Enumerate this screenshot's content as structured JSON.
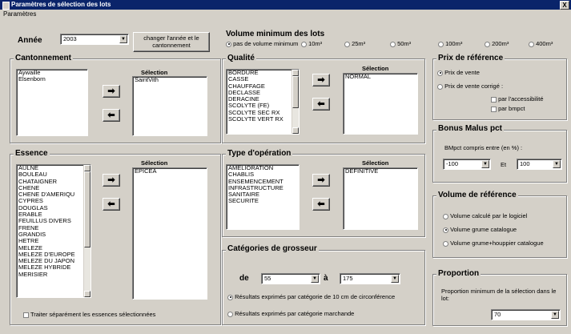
{
  "window": {
    "title": "Paramètres de sélection des lots",
    "close_label": "X"
  },
  "menu": {
    "item": "Paramètres"
  },
  "annee": {
    "label": "Année",
    "value": "2003",
    "change_button": "changer l'année et le cantonnement"
  },
  "volume_min": {
    "title": "Volume minimum des lots",
    "options": [
      "pas de volume minimum",
      "10m³",
      "25m³",
      "50m³",
      "100m³",
      "200m³",
      "400m³"
    ],
    "selected": "pas de volume minimum"
  },
  "cantonnement": {
    "title": "Cantonnement",
    "available": [
      "Aywaille",
      "Elsenborn"
    ],
    "selection_label": "Sélection",
    "selected": [
      "SaintVith"
    ]
  },
  "qualite": {
    "title": "Qualité",
    "available": [
      "BORDURE",
      "CASSE",
      "CHAUFFAGE",
      "DECLASSE",
      "DERACINE",
      "SCOLYTE (FE)",
      "SCOLYTE SEC RX",
      "SCOLYTE VERT RX"
    ],
    "selection_label": "Sélection",
    "selected": [
      "NORMAL"
    ]
  },
  "essence": {
    "title": "Essence",
    "available": [
      "AULNE",
      "BOULEAU",
      "CHATAIGNER",
      "CHENE",
      "CHENE D'AMERIQU",
      "CYPRES",
      "DOUGLAS",
      "ERABLE",
      "FEUILLUS DIVERS",
      "FRENE",
      "GRANDIS",
      "HETRE",
      "MELEZE",
      "MELEZE D'EUROPE",
      "MELEZE DU JAPON",
      "MELEZE HYBRIDE",
      "MERISIER"
    ],
    "selection_label": "Sélection",
    "selected": [
      "EPICEA"
    ],
    "checkbox_label": "Traiter séparément les essences sélectionnées"
  },
  "type_operation": {
    "title": "Type d'opération",
    "available": [
      "AMELIORATION",
      "CHABLIS",
      "ENSEMENCEMENT",
      "INFRASTRUCTURE",
      "SANITAIRE",
      "SECURITE"
    ],
    "selection_label": "Sélection",
    "selected": [
      "DEFINITIVE"
    ]
  },
  "prix_reference": {
    "title": "Prix de référence",
    "option1": "Prix de vente",
    "option2": "Prix de vente corrigé :",
    "check1": "par l'accessibilité",
    "check2": "par bmpct"
  },
  "bonus_malus": {
    "title": "Bonus Malus pct",
    "range_label": "BMpct compris entre (en %) :",
    "from": "-100",
    "et": "Et",
    "to": "100"
  },
  "volume_reference": {
    "title": "Volume de référence",
    "options": [
      "Volume calculé par le logiciel",
      "Volume grume catalogue",
      "Volume grume+houppier catalogue"
    ],
    "selected": "Volume grume catalogue"
  },
  "categories": {
    "title": "Catégories de grosseur",
    "de_label": "de",
    "de_value": "55",
    "a_label": "à",
    "a_value": "175",
    "option1": "Résultats exprimés par catégorie de 10 cm de circonférence",
    "option2": "Résultats exprimés par catégorie marchande"
  },
  "proportion": {
    "title": "Proportion",
    "label": "Proportion minimum de la sélection dans le lot:",
    "value": "70"
  },
  "icons": {
    "add": "➡",
    "remove": "⬅",
    "dropdown": "▼"
  }
}
